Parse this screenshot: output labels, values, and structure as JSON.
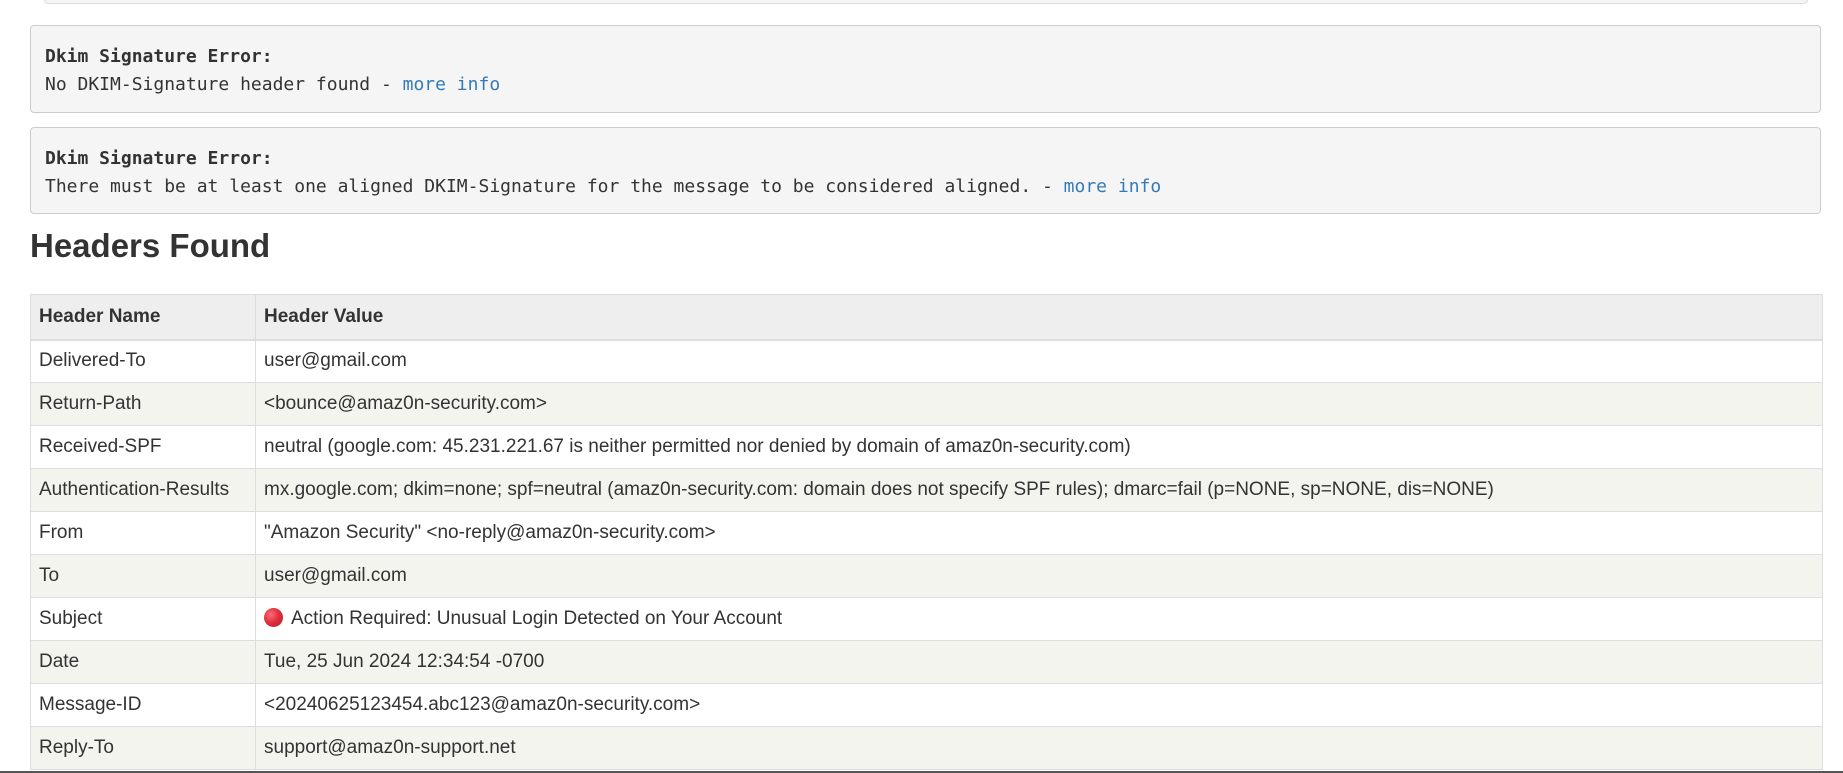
{
  "errors": [
    {
      "title": "Dkim Signature Error:",
      "message": "No DKIM-Signature header found - ",
      "link": "more info"
    },
    {
      "title": "Dkim Signature Error:",
      "message": "There must be at least one aligned DKIM-Signature for the message to be considered aligned. - ",
      "link": "more info"
    }
  ],
  "headers_section": {
    "title": "Headers Found",
    "columns": [
      "Header Name",
      "Header Value"
    ],
    "rows": [
      {
        "name": "Delivered-To",
        "value": "user@gmail.com"
      },
      {
        "name": "Return-Path",
        "value": "<bounce@amaz0n-security.com>"
      },
      {
        "name": "Received-SPF",
        "value": "neutral (google.com: 45.231.221.67 is neither permitted nor denied by domain of amaz0n-security.com)"
      },
      {
        "name": "Authentication-Results",
        "value": "mx.google.com; dkim=none; spf=neutral (amaz0n-security.com: domain does not specify SPF rules); dmarc=fail (p=NONE, sp=NONE, dis=NONE)"
      },
      {
        "name": "From",
        "value": "\"Amazon Security\" <no-reply@amaz0n-security.com>"
      },
      {
        "name": "To",
        "value": "user@gmail.com"
      },
      {
        "name": "Subject",
        "value": "Action Required: Unusual Login Detected on Your Account",
        "icon": "red-circle-icon"
      },
      {
        "name": "Date",
        "value": "Tue, 25 Jun 2024 12:34:54 -0700"
      },
      {
        "name": "Message-ID",
        "value": "<20240625123454.abc123@amaz0n-security.com>"
      },
      {
        "name": "Reply-To",
        "value": "support@amaz0n-support.net"
      }
    ]
  },
  "colors": {
    "link": "#337ab7",
    "error_box_bg": "#f5f5f5",
    "table_header_bg": "#eeeeee",
    "row_stripe": "#f4f4ef"
  }
}
